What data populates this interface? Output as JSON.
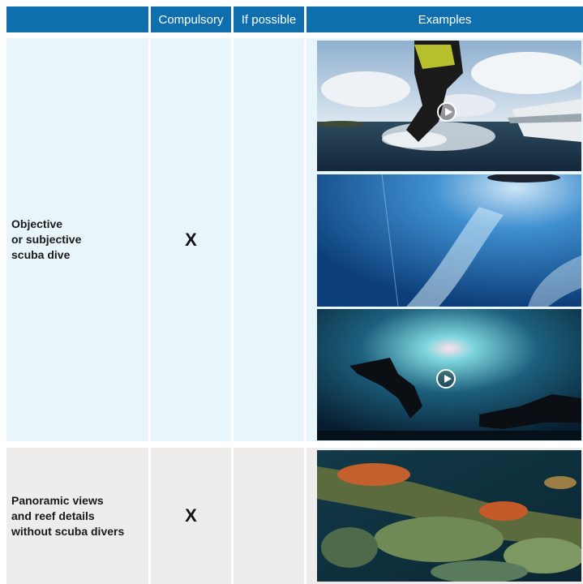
{
  "table": {
    "headers": {
      "compulsory": "Compulsory",
      "if_possible": "If possible",
      "examples": "Examples"
    },
    "rows": [
      {
        "label_lines": [
          "Objective",
          "or subjective",
          "scuba dive"
        ],
        "compulsory_mark": "X",
        "if_possible_mark": "",
        "examples": [
          {
            "type": "video",
            "subject": "diver-entering-water"
          },
          {
            "type": "image",
            "subject": "underwater-surface-bubbles"
          },
          {
            "type": "video",
            "subject": "divers-silhouette-sunlight"
          }
        ]
      },
      {
        "label_lines": [
          "Panoramic views",
          "and reef details",
          "without scuba divers"
        ],
        "compulsory_mark": "X",
        "if_possible_mark": "",
        "examples": [
          {
            "type": "image",
            "subject": "coral-reef-wreck"
          }
        ]
      }
    ]
  },
  "colors": {
    "header_blue": "#0f6fae",
    "row1_bg": "#e8f5fb",
    "row2_bg": "#efedeb"
  }
}
